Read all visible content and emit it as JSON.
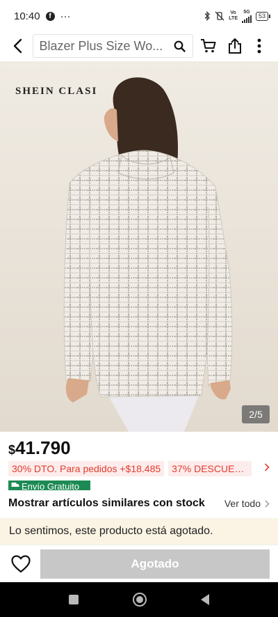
{
  "status_bar": {
    "time": "10:40",
    "fb_letter": "f",
    "more": "···",
    "net_top": "Vo",
    "net_bottom": "LTE",
    "net2_top": "5G",
    "battery": "53"
  },
  "header": {
    "search_text": "Blazer Plus Size Wo..."
  },
  "product": {
    "brand": "SHEIN CLASI",
    "image_counter": "2/5",
    "currency": "$",
    "price": "41.790",
    "promo1": "30% DTO. Para pedidos +$18.485",
    "promo2": "37% DESCUEN...",
    "free_shipping": "Envío Gratuito"
  },
  "similar": {
    "title": "Mostrar artículos similares con stock",
    "see_all": "Ver todo"
  },
  "notice": {
    "text": "Lo sentimos, este producto está agotado."
  },
  "bottom": {
    "sold_out": "Agotado"
  },
  "colors": {
    "promo_red": "#e23b2f",
    "promo_bg": "#fdecec",
    "ship_green": "#1d8a54",
    "notice_bg": "#fbf4e4",
    "soldout_gray": "#c7c7c7"
  },
  "icons": [
    "back-arrow-icon",
    "search-icon",
    "cart-icon",
    "share-icon",
    "more-vert-icon",
    "heart-icon",
    "truck-icon",
    "chevron-right-icon"
  ]
}
